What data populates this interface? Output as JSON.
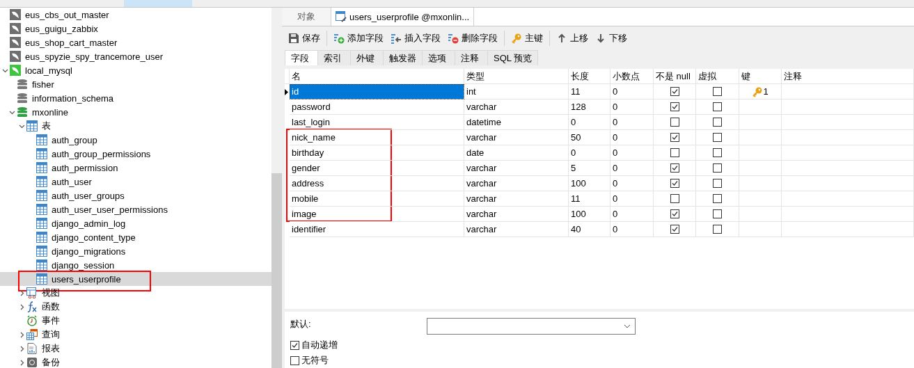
{
  "tree": [
    {
      "label": "eus_cbs_out_master",
      "kind": "connection",
      "expanded": false,
      "selected": false
    },
    {
      "label": "eus_guigu_zabbix",
      "kind": "connection",
      "expanded": false,
      "selected": false
    },
    {
      "label": "eus_shop_cart_master",
      "kind": "connection",
      "expanded": false,
      "selected": false
    },
    {
      "label": "eus_spyzie_spy_trancemore_user",
      "kind": "connection",
      "expanded": false,
      "selected": false
    },
    {
      "label": "local_mysql",
      "kind": "connection",
      "expanded": true,
      "selected": false,
      "children": [
        {
          "label": "fisher",
          "kind": "database",
          "selected": false
        },
        {
          "label": "information_schema",
          "kind": "database",
          "selected": false
        },
        {
          "label": "mxonline",
          "kind": "database",
          "expanded": true,
          "selected": false,
          "children": [
            {
              "label": "表",
              "kind": "tables",
              "expanded": true,
              "selected": false,
              "children": [
                {
                  "label": "auth_group",
                  "kind": "table",
                  "selected": false,
                  "annotated": false
                },
                {
                  "label": "auth_group_permissions",
                  "kind": "table",
                  "selected": false,
                  "annotated": false
                },
                {
                  "label": "auth_permission",
                  "kind": "table",
                  "selected": false,
                  "annotated": false
                },
                {
                  "label": "auth_user",
                  "kind": "table",
                  "selected": false,
                  "annotated": false
                },
                {
                  "label": "auth_user_groups",
                  "kind": "table",
                  "selected": false,
                  "annotated": false
                },
                {
                  "label": "auth_user_user_permissions",
                  "kind": "table",
                  "selected": false,
                  "annotated": false
                },
                {
                  "label": "django_admin_log",
                  "kind": "table",
                  "selected": false,
                  "annotated": false
                },
                {
                  "label": "django_content_type",
                  "kind": "table",
                  "selected": false,
                  "annotated": false
                },
                {
                  "label": "django_migrations",
                  "kind": "table",
                  "selected": false,
                  "annotated": false
                },
                {
                  "label": "django_session",
                  "kind": "table",
                  "selected": false,
                  "annotated": false
                },
                {
                  "label": "users_userprofile",
                  "kind": "table",
                  "selected": true,
                  "annotated": true
                }
              ]
            },
            {
              "label": "视图",
              "kind": "view",
              "expanded": false,
              "selected": false
            },
            {
              "label": "函数",
              "kind": "function",
              "expanded": false,
              "selected": false
            },
            {
              "label": "事件",
              "kind": "event",
              "selected": false
            },
            {
              "label": "查询",
              "kind": "query",
              "expanded": false,
              "selected": false
            },
            {
              "label": "报表",
              "kind": "report",
              "expanded": false,
              "selected": false
            },
            {
              "label": "备份",
              "kind": "backup",
              "expanded": false,
              "selected": false
            }
          ]
        }
      ]
    }
  ],
  "doc_tabs": [
    {
      "label": "对象",
      "selected": false
    },
    {
      "label": "users_userprofile @mxonlin...",
      "selected": true
    }
  ],
  "toolbar": [
    {
      "label": "保存",
      "kind": "save"
    },
    {
      "label": "添加字段",
      "kind": "add"
    },
    {
      "label": "插入字段",
      "kind": "insert"
    },
    {
      "label": "删除字段",
      "kind": "delete"
    },
    {
      "label": "主键",
      "kind": "key"
    },
    {
      "label": "上移",
      "kind": "up"
    },
    {
      "label": "下移",
      "kind": "down"
    }
  ],
  "sub_tabs": [
    {
      "label": "字段",
      "selected": true
    },
    {
      "label": "索引",
      "selected": false
    },
    {
      "label": "外键",
      "selected": false
    },
    {
      "label": "触发器",
      "selected": false
    },
    {
      "label": "选项",
      "selected": false
    },
    {
      "label": "注释",
      "selected": false
    },
    {
      "label": "SQL 预览",
      "selected": false
    }
  ],
  "table": {
    "columns": [
      "名",
      "类型",
      "长度",
      "小数点",
      "不是 null",
      "虚拟",
      "键",
      "注释"
    ],
    "rows": [
      {
        "name": "id",
        "type": "int",
        "length": "11",
        "decimals": "0",
        "not_null": true,
        "virtual": false,
        "key": "1",
        "selected": true,
        "annotated": false
      },
      {
        "name": "password",
        "type": "varchar",
        "length": "128",
        "decimals": "0",
        "not_null": true,
        "virtual": false,
        "selected": false,
        "annotated": false
      },
      {
        "name": "last_login",
        "type": "datetime",
        "length": "0",
        "decimals": "0",
        "not_null": false,
        "virtual": false,
        "selected": false,
        "annotated": false
      },
      {
        "name": "nick_name",
        "type": "varchar",
        "length": "50",
        "decimals": "0",
        "not_null": true,
        "virtual": false,
        "selected": false,
        "annotated": true
      },
      {
        "name": "birthday",
        "type": "date",
        "length": "0",
        "decimals": "0",
        "not_null": false,
        "virtual": false,
        "selected": false,
        "annotated": true
      },
      {
        "name": "gender",
        "type": "varchar",
        "length": "5",
        "decimals": "0",
        "not_null": true,
        "virtual": false,
        "selected": false,
        "annotated": true
      },
      {
        "name": "address",
        "type": "varchar",
        "length": "100",
        "decimals": "0",
        "not_null": true,
        "virtual": false,
        "selected": false,
        "annotated": true
      },
      {
        "name": "mobile",
        "type": "varchar",
        "length": "11",
        "decimals": "0",
        "not_null": false,
        "virtual": false,
        "selected": false,
        "annotated": true
      },
      {
        "name": "image",
        "type": "varchar",
        "length": "100",
        "decimals": "0",
        "not_null": true,
        "virtual": false,
        "selected": false,
        "annotated": true
      },
      {
        "name": "identifier",
        "type": "varchar",
        "length": "40",
        "decimals": "0",
        "not_null": true,
        "virtual": false,
        "selected": false,
        "annotated": false
      }
    ]
  },
  "properties": {
    "default_label": "默认:",
    "options": [
      {
        "label": "自动递增",
        "checked": true
      },
      {
        "label": "无符号",
        "checked": false
      }
    ]
  }
}
